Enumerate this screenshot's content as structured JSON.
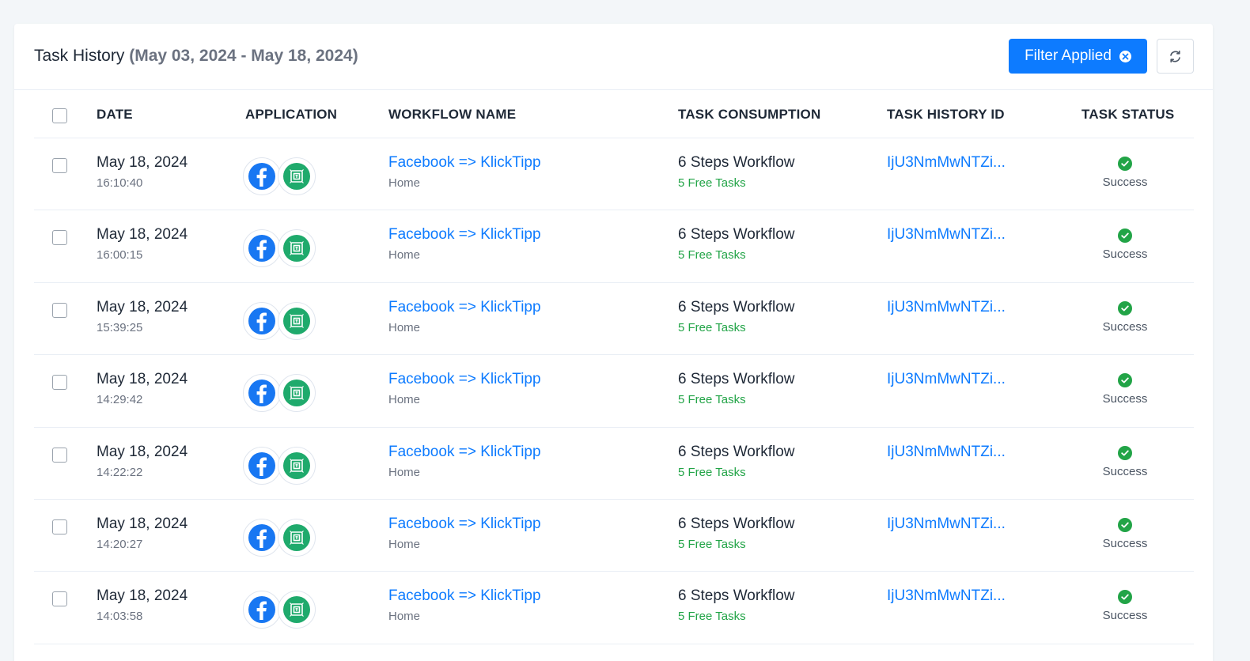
{
  "header": {
    "title": "Task History",
    "date_range": "(May 03, 2024 - May 18, 2024)",
    "filter_button": "Filter Applied"
  },
  "table": {
    "columns": [
      "DATE",
      "APPLICATION",
      "WORKFLOW NAME",
      "TASK CONSUMPTION",
      "TASK HISTORY ID",
      "TASK STATUS"
    ],
    "rows": [
      {
        "date": "May 18, 2024",
        "time": "16:10:40",
        "apps": [
          "facebook-icon",
          "klicktipp-icon"
        ],
        "workflow": "Facebook => KlickTipp",
        "folder": "Home",
        "consumption": "6 Steps Workflow",
        "free_tasks": "5 Free Tasks",
        "history_id": "IjU3NmMwNTZi...",
        "status": "Success"
      },
      {
        "date": "May 18, 2024",
        "time": "16:00:15",
        "apps": [
          "facebook-icon",
          "klicktipp-icon"
        ],
        "workflow": "Facebook => KlickTipp",
        "folder": "Home",
        "consumption": "6 Steps Workflow",
        "free_tasks": "5 Free Tasks",
        "history_id": "IjU3NmMwNTZi...",
        "status": "Success"
      },
      {
        "date": "May 18, 2024",
        "time": "15:39:25",
        "apps": [
          "facebook-icon",
          "klicktipp-icon"
        ],
        "workflow": "Facebook => KlickTipp",
        "folder": "Home",
        "consumption": "6 Steps Workflow",
        "free_tasks": "5 Free Tasks",
        "history_id": "IjU3NmMwNTZi...",
        "status": "Success"
      },
      {
        "date": "May 18, 2024",
        "time": "14:29:42",
        "apps": [
          "facebook-icon",
          "klicktipp-icon"
        ],
        "workflow": "Facebook => KlickTipp",
        "folder": "Home",
        "consumption": "6 Steps Workflow",
        "free_tasks": "5 Free Tasks",
        "history_id": "IjU3NmMwNTZi...",
        "status": "Success"
      },
      {
        "date": "May 18, 2024",
        "time": "14:22:22",
        "apps": [
          "facebook-icon",
          "klicktipp-icon"
        ],
        "workflow": "Facebook => KlickTipp",
        "folder": "Home",
        "consumption": "6 Steps Workflow",
        "free_tasks": "5 Free Tasks",
        "history_id": "IjU3NmMwNTZi...",
        "status": "Success"
      },
      {
        "date": "May 18, 2024",
        "time": "14:20:27",
        "apps": [
          "facebook-icon",
          "klicktipp-icon"
        ],
        "workflow": "Facebook => KlickTipp",
        "folder": "Home",
        "consumption": "6 Steps Workflow",
        "free_tasks": "5 Free Tasks",
        "history_id": "IjU3NmMwNTZi...",
        "status": "Success"
      },
      {
        "date": "May 18, 2024",
        "time": "14:03:58",
        "apps": [
          "facebook-icon",
          "klicktipp-icon"
        ],
        "workflow": "Facebook => KlickTipp",
        "folder": "Home",
        "consumption": "6 Steps Workflow",
        "free_tasks": "5 Free Tasks",
        "history_id": "IjU3NmMwNTZi...",
        "status": "Success"
      }
    ]
  },
  "colors": {
    "accent": "#0d7bff",
    "success": "#22a447",
    "facebook": "#1877f2",
    "klicktipp": "#1faa6c"
  }
}
